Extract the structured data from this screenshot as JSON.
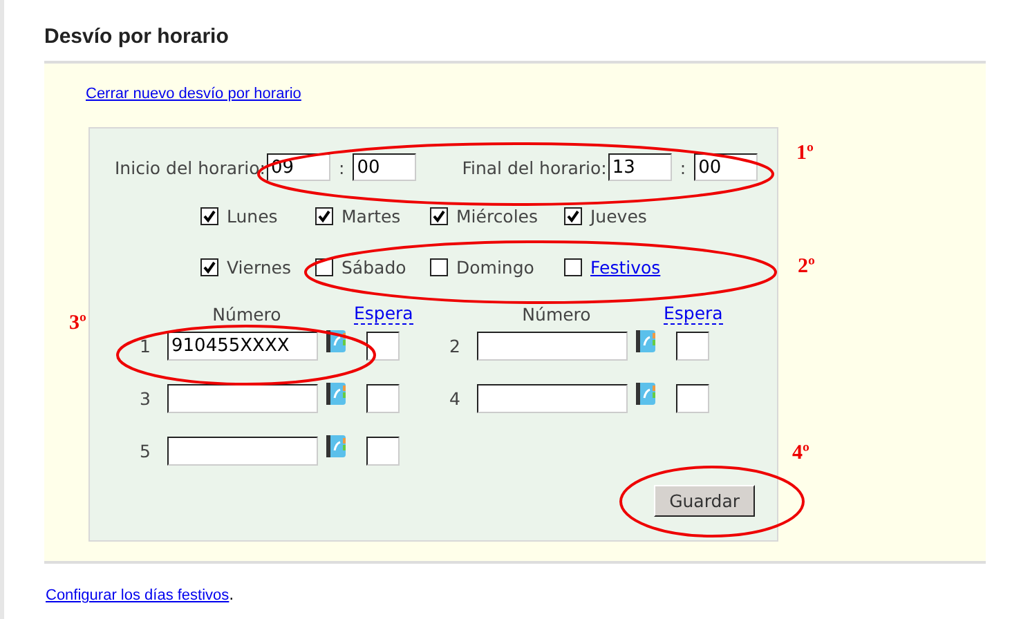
{
  "title": "Desvío por horario",
  "close_link": "Cerrar nuevo desvío por horario",
  "schedule": {
    "start_label": "Inicio del horario:",
    "start_hour": "09",
    "start_minute": "00",
    "separator": ":",
    "end_label": "Final del horario:",
    "end_hour": "13",
    "end_minute": "00"
  },
  "days": [
    {
      "label": "Lunes",
      "checked": true,
      "kind": "text"
    },
    {
      "label": "Martes",
      "checked": true,
      "kind": "text"
    },
    {
      "label": "Miércoles",
      "checked": true,
      "kind": "text"
    },
    {
      "label": "Jueves",
      "checked": true,
      "kind": "text"
    },
    {
      "label": "Viernes",
      "checked": true,
      "kind": "text"
    },
    {
      "label": "Sábado",
      "checked": false,
      "kind": "text"
    },
    {
      "label": "Domingo",
      "checked": false,
      "kind": "text"
    },
    {
      "label": "Festivos",
      "checked": false,
      "kind": "link"
    }
  ],
  "number_headers": [
    {
      "number": "Número",
      "wait": "Espera"
    },
    {
      "number": "Número",
      "wait": "Espera"
    }
  ],
  "numbers": [
    {
      "index": "1",
      "value": "910455XXXX"
    },
    {
      "index": "2"
    },
    {
      "index": "3"
    },
    {
      "index": "4"
    },
    {
      "index": "5"
    }
  ],
  "save_button": "Guardar",
  "annotations": [
    "1º",
    "2º",
    "3º",
    "4º"
  ],
  "footer": {
    "link": "Configurar los días festivos",
    "suffix": "."
  }
}
